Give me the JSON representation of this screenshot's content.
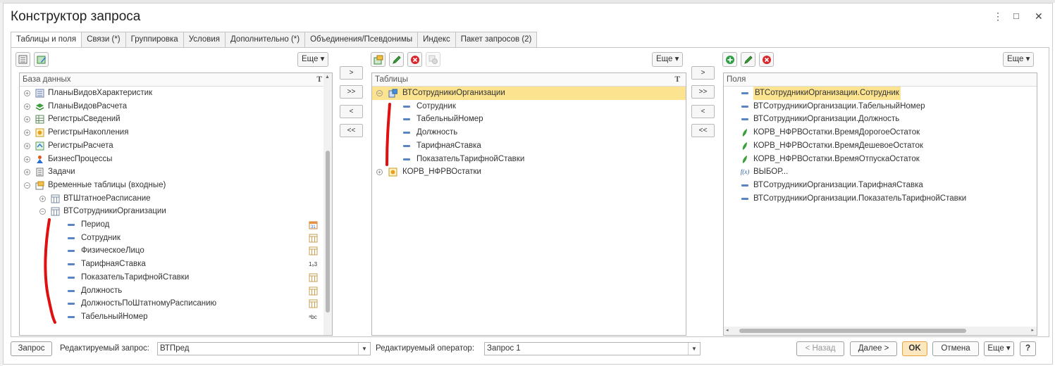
{
  "window": {
    "title": "Конструктор запроса",
    "menu_icon": "⋮",
    "maximize_icon": "□",
    "close_icon": "✕"
  },
  "tabs": [
    "Таблицы и поля",
    "Связи (*)",
    "Группировка",
    "Условия",
    "Дополнительно (*)",
    "Объединения/Псевдонимы",
    "Индекс",
    "Пакет запросов (2)"
  ],
  "db_panel": {
    "more_label": "Еще ▾",
    "header": "База данных",
    "header_icon": "T",
    "items": [
      {
        "label": "ПланыВидовХарактеристик",
        "icon": "table-list-icon",
        "expand": "+"
      },
      {
        "label": "ПланыВидовРасчета",
        "icon": "plan-calc-icon",
        "expand": "+"
      },
      {
        "label": "РегистрыСведений",
        "icon": "grid-register-icon",
        "expand": "+"
      },
      {
        "label": "РегистрыНакопления",
        "icon": "accum-register-icon",
        "expand": "+"
      },
      {
        "label": "РегистрыРасчета",
        "icon": "calc-register-icon",
        "expand": "+"
      },
      {
        "label": "БизнесПроцессы",
        "icon": "business-process-icon",
        "expand": "+"
      },
      {
        "label": "Задачи",
        "icon": "tasks-icon",
        "expand": "+"
      },
      {
        "label": "Временные таблицы (входные)",
        "icon": "temp-tables-icon",
        "expand": "−"
      },
      {
        "label": "ВТШтатноеРасписание",
        "icon": "table-icon",
        "expand": "+"
      },
      {
        "label": "ВТСотрудникиОрганизации",
        "icon": "table-icon",
        "expand": "−"
      },
      {
        "label": "Период",
        "icon": "field-icon",
        "type": "calendar-type-icon"
      },
      {
        "label": "Сотрудник",
        "icon": "field-icon",
        "type": "table-type-icon"
      },
      {
        "label": "ФизическоеЛицо",
        "icon": "field-icon",
        "type": "table-type-icon"
      },
      {
        "label": "ТарифнаяСтавка",
        "icon": "field-icon",
        "type": "number-type-icon",
        "type_text": "1₉3"
      },
      {
        "label": "ПоказательТарифнойСтавки",
        "icon": "field-icon",
        "type": "table-type-icon"
      },
      {
        "label": "Должность",
        "icon": "field-icon",
        "type": "table-type-icon"
      },
      {
        "label": "ДолжностьПоШтатномуРасписанию",
        "icon": "field-icon",
        "type": "table-type-icon"
      },
      {
        "label": "ТабельныйНомер",
        "icon": "field-icon",
        "type": "string-type-icon",
        "type_text": "ᵃbc"
      }
    ]
  },
  "arrows": [
    ">",
    ">>",
    "<",
    "<<"
  ],
  "tables_panel": {
    "more_label": "Еще ▾",
    "header": "Таблицы",
    "header_icon": "T",
    "items": [
      {
        "label": "ВТСотрудникиОрганизации",
        "expand": "−",
        "selected": true
      },
      {
        "label": "Сотрудник"
      },
      {
        "label": "ТабельныйНомер"
      },
      {
        "label": "Должность"
      },
      {
        "label": "ТарифнаяСтавка"
      },
      {
        "label": "ПоказательТарифнойСтавки"
      },
      {
        "label": "КОРВ_НФРВОстатки",
        "expand": "+"
      }
    ]
  },
  "fields_panel": {
    "more_label": "Еще ▾",
    "header": "Поля",
    "items": [
      {
        "label": "ВТСотрудникиОрганизации.Сотрудник",
        "kind": "field",
        "selected": true
      },
      {
        "label": "ВТСотрудникиОрганизации.ТабельныйНомер",
        "kind": "field"
      },
      {
        "label": "ВТСотрудникиОрганизации.Должность",
        "kind": "field"
      },
      {
        "label": "КОРВ_НФРВОстатки.ВремяДорогоеОстаток",
        "kind": "resource"
      },
      {
        "label": "КОРВ_НФРВОстатки.ВремяДешевоеОстаток",
        "kind": "resource"
      },
      {
        "label": "КОРВ_НФРВОстатки.ВремяОтпускаОстаток",
        "kind": "resource"
      },
      {
        "label": "ВЫБОР...",
        "kind": "expression",
        "icon_text": "f(x)"
      },
      {
        "label": "ВТСотрудникиОрганизации.ТарифнаяСтавка",
        "kind": "field"
      },
      {
        "label": "ВТСотрудникиОрганизации.ПоказательТарифнойСтавки",
        "kind": "field"
      }
    ]
  },
  "bottom": {
    "query_button": "Запрос",
    "edited_query_label": "Редактируемый запрос:",
    "edited_query_value": "ВТПред",
    "edited_operator_label": "Редактируемый оператор:",
    "edited_operator_value": "Запрос 1",
    "back_button": "< Назад",
    "next_button": "Далее >",
    "ok_button": "OK",
    "cancel_button": "Отмена",
    "more_button": "Еще ▾",
    "help_button": "?"
  },
  "colors": {
    "selection": "#fbe38f",
    "accent_ok": "#f5a623",
    "red_annotation": "#e01010"
  }
}
